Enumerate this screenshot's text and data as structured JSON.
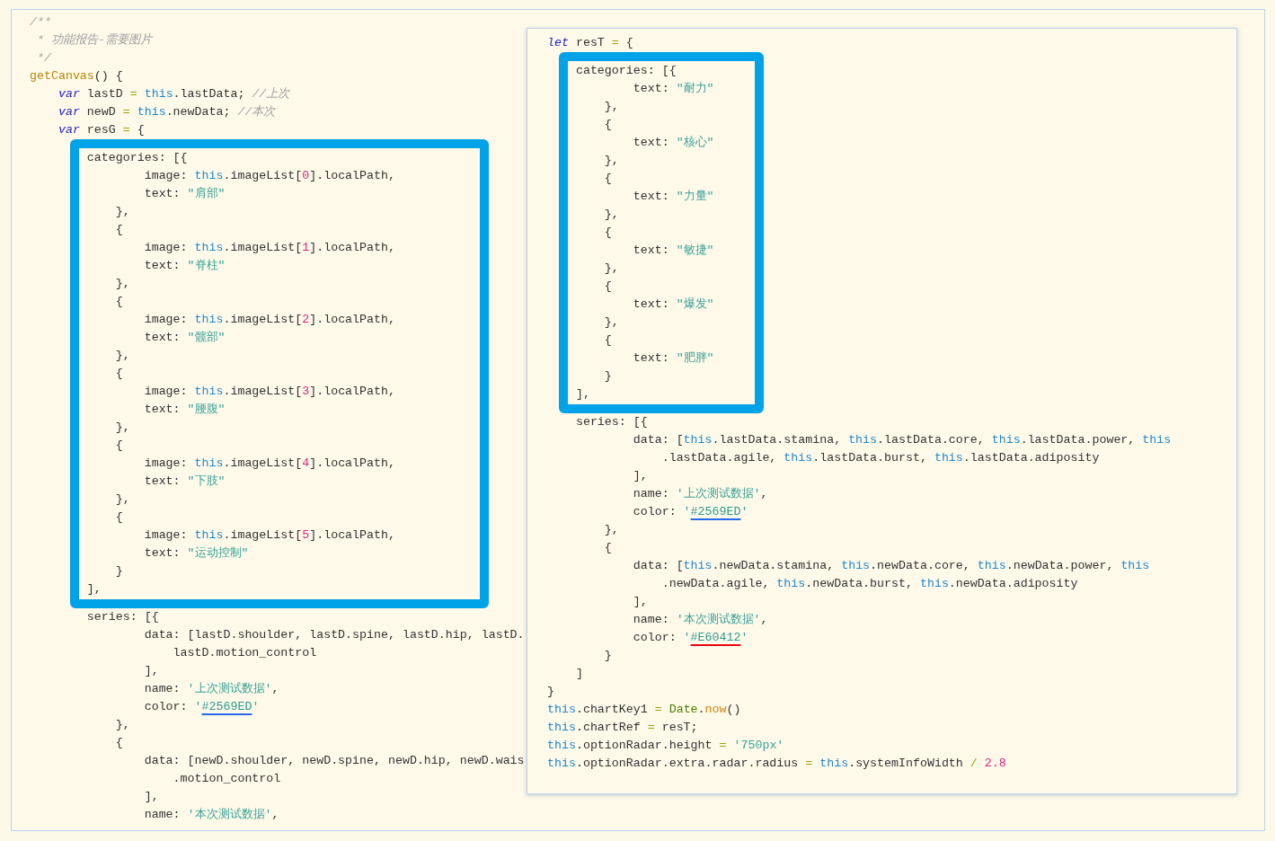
{
  "panels": [
    {
      "kind": "editor",
      "blocks": [
        {
          "highlighted": false,
          "lines": [
            [
              {
                "kind": "c",
                "text": "/**"
              }
            ],
            [
              {
                "kind": "c",
                "text": " * 功能报告-需要图片"
              }
            ],
            [
              {
                "kind": "c",
                "text": " */"
              }
            ],
            [
              {
                "kind": "f",
                "text": "getCanvas"
              },
              {
                "kind": "p",
                "text": "() {"
              }
            ],
            [
              {
                "kind": "k",
                "text": "    var"
              },
              {
                "kind": "p",
                "text": " lastD "
              },
              {
                "kind": "o",
                "text": "= "
              },
              {
                "kind": "t",
                "text": "this"
              },
              {
                "kind": "p",
                "text": ".lastData; "
              },
              {
                "kind": "c",
                "text": "//上次"
              }
            ],
            [
              {
                "kind": "k",
                "text": "    var"
              },
              {
                "kind": "p",
                "text": " newD "
              },
              {
                "kind": "o",
                "text": "= "
              },
              {
                "kind": "t",
                "text": "this"
              },
              {
                "kind": "p",
                "text": ".newData; "
              },
              {
                "kind": "c",
                "text": "//本次"
              }
            ],
            [
              {
                "kind": "k",
                "text": "    var"
              },
              {
                "kind": "p",
                "text": " resG "
              },
              {
                "kind": "o",
                "text": "="
              },
              {
                "kind": "p",
                "text": " {"
              }
            ]
          ]
        },
        {
          "highlighted": true,
          "lines": [
            [
              {
                "kind": "p",
                "text": "        categories: [{"
              }
            ],
            [
              {
                "kind": "p",
                "text": "                image: "
              },
              {
                "kind": "t",
                "text": "this"
              },
              {
                "kind": "p",
                "text": ".imageList["
              },
              {
                "kind": "n",
                "text": "0"
              },
              {
                "kind": "p",
                "text": "].localPath,"
              }
            ],
            [
              {
                "kind": "p",
                "text": "                text: "
              },
              {
                "kind": "s",
                "text": "\"肩部\""
              }
            ],
            [
              {
                "kind": "p",
                "text": "            },"
              }
            ],
            [
              {
                "kind": "p",
                "text": "            {"
              }
            ],
            [
              {
                "kind": "p",
                "text": "                image: "
              },
              {
                "kind": "t",
                "text": "this"
              },
              {
                "kind": "p",
                "text": ".imageList["
              },
              {
                "kind": "n",
                "text": "1"
              },
              {
                "kind": "p",
                "text": "].localPath,"
              }
            ],
            [
              {
                "kind": "p",
                "text": "                text: "
              },
              {
                "kind": "s",
                "text": "\"脊柱\""
              }
            ],
            [
              {
                "kind": "p",
                "text": "            },"
              }
            ],
            [
              {
                "kind": "p",
                "text": "            {"
              }
            ],
            [
              {
                "kind": "p",
                "text": "                image: "
              },
              {
                "kind": "t",
                "text": "this"
              },
              {
                "kind": "p",
                "text": ".imageList["
              },
              {
                "kind": "n",
                "text": "2"
              },
              {
                "kind": "p",
                "text": "].localPath,"
              }
            ],
            [
              {
                "kind": "p",
                "text": "                text: "
              },
              {
                "kind": "s",
                "text": "\"髋部\""
              }
            ],
            [
              {
                "kind": "p",
                "text": "            },"
              }
            ],
            [
              {
                "kind": "p",
                "text": "            {"
              }
            ],
            [
              {
                "kind": "p",
                "text": "                image: "
              },
              {
                "kind": "t",
                "text": "this"
              },
              {
                "kind": "p",
                "text": ".imageList["
              },
              {
                "kind": "n",
                "text": "3"
              },
              {
                "kind": "p",
                "text": "].localPath,"
              }
            ],
            [
              {
                "kind": "p",
                "text": "                text: "
              },
              {
                "kind": "s",
                "text": "\"腰腹\""
              }
            ],
            [
              {
                "kind": "p",
                "text": "            },"
              }
            ],
            [
              {
                "kind": "p",
                "text": "            {"
              }
            ],
            [
              {
                "kind": "p",
                "text": "                image: "
              },
              {
                "kind": "t",
                "text": "this"
              },
              {
                "kind": "p",
                "text": ".imageList["
              },
              {
                "kind": "n",
                "text": "4"
              },
              {
                "kind": "p",
                "text": "].localPath,"
              }
            ],
            [
              {
                "kind": "p",
                "text": "                text: "
              },
              {
                "kind": "s",
                "text": "\"下肢\""
              }
            ],
            [
              {
                "kind": "p",
                "text": "            },"
              }
            ],
            [
              {
                "kind": "p",
                "text": "            {"
              }
            ],
            [
              {
                "kind": "p",
                "text": "                image: "
              },
              {
                "kind": "t",
                "text": "this"
              },
              {
                "kind": "p",
                "text": ".imageList["
              },
              {
                "kind": "n",
                "text": "5"
              },
              {
                "kind": "p",
                "text": "].localPath,"
              }
            ],
            [
              {
                "kind": "p",
                "text": "                text: "
              },
              {
                "kind": "s",
                "text": "\"运动控制\""
              }
            ],
            [
              {
                "kind": "p",
                "text": "            }"
              }
            ],
            [
              {
                "kind": "p",
                "text": "        ],"
              }
            ]
          ]
        },
        {
          "highlighted": false,
          "lines": [
            [
              {
                "kind": "p",
                "text": "        series: [{"
              }
            ],
            [
              {
                "kind": "p",
                "text": "                data: [lastD.shoulder, lastD.spine, lastD.hip, lastD."
              }
            ],
            [
              {
                "kind": "p",
                "text": "                    lastD.motion_control"
              }
            ],
            [
              {
                "kind": "p",
                "text": "                ],"
              }
            ],
            [
              {
                "kind": "p",
                "text": "                name: "
              },
              {
                "kind": "s",
                "text": "'上次测试数据'"
              },
              {
                "kind": "p",
                "text": ","
              }
            ],
            [
              {
                "kind": "p",
                "text": "                color: "
              },
              {
                "kind": "s",
                "text": "'"
              },
              {
                "kind": "x",
                "text": "#2569ED",
                "color": "#2569ed"
              },
              {
                "kind": "s",
                "text": "'"
              }
            ],
            [
              {
                "kind": "p",
                "text": "            },"
              }
            ],
            [
              {
                "kind": "p",
                "text": "            {"
              }
            ],
            [
              {
                "kind": "p",
                "text": "                data: [newD.shoulder, newD.spine, newD.hip, newD.wais"
              }
            ],
            [
              {
                "kind": "p",
                "text": "                    .motion_control"
              }
            ],
            [
              {
                "kind": "p",
                "text": "                ],"
              }
            ],
            [
              {
                "kind": "p",
                "text": "                name: "
              },
              {
                "kind": "s",
                "text": "'本次测试数据'"
              },
              {
                "kind": "p",
                "text": ","
              }
            ]
          ]
        }
      ]
    },
    {
      "kind": "popup",
      "blocks": [
        {
          "highlighted": false,
          "lines": [
            [
              {
                "kind": "k",
                "text": "let"
              },
              {
                "kind": "p",
                "text": " resT "
              },
              {
                "kind": "o",
                "text": "="
              },
              {
                "kind": "p",
                "text": " {"
              }
            ]
          ]
        },
        {
          "highlighted": true,
          "lines": [
            [
              {
                "kind": "p",
                "text": "    categories: [{"
              }
            ],
            [
              {
                "kind": "p",
                "text": "            text: "
              },
              {
                "kind": "s",
                "text": "\"耐力\""
              }
            ],
            [
              {
                "kind": "p",
                "text": "        },"
              }
            ],
            [
              {
                "kind": "p",
                "text": "        {"
              }
            ],
            [
              {
                "kind": "p",
                "text": "            text: "
              },
              {
                "kind": "s",
                "text": "\"核心\""
              }
            ],
            [
              {
                "kind": "p",
                "text": "        },"
              }
            ],
            [
              {
                "kind": "p",
                "text": "        {"
              }
            ],
            [
              {
                "kind": "p",
                "text": "            text: "
              },
              {
                "kind": "s",
                "text": "\"力量\""
              }
            ],
            [
              {
                "kind": "p",
                "text": "        },"
              }
            ],
            [
              {
                "kind": "p",
                "text": "        {"
              }
            ],
            [
              {
                "kind": "p",
                "text": "            text: "
              },
              {
                "kind": "s",
                "text": "\"敏捷\""
              }
            ],
            [
              {
                "kind": "p",
                "text": "        },"
              }
            ],
            [
              {
                "kind": "p",
                "text": "        {"
              }
            ],
            [
              {
                "kind": "p",
                "text": "            text: "
              },
              {
                "kind": "s",
                "text": "\"爆发\""
              }
            ],
            [
              {
                "kind": "p",
                "text": "        },"
              }
            ],
            [
              {
                "kind": "p",
                "text": "        {"
              }
            ],
            [
              {
                "kind": "p",
                "text": "            text: "
              },
              {
                "kind": "s",
                "text": "\"肥胖\""
              }
            ],
            [
              {
                "kind": "p",
                "text": "        }"
              }
            ],
            [
              {
                "kind": "p",
                "text": "    ],"
              }
            ]
          ]
        },
        {
          "highlighted": false,
          "lines": [
            [
              {
                "kind": "p",
                "text": "    series: [{"
              }
            ],
            [
              {
                "kind": "p",
                "text": "            data: ["
              },
              {
                "kind": "t",
                "text": "this"
              },
              {
                "kind": "p",
                "text": ".lastData.stamina, "
              },
              {
                "kind": "t",
                "text": "this"
              },
              {
                "kind": "p",
                "text": ".lastData.core, "
              },
              {
                "kind": "t",
                "text": "this"
              },
              {
                "kind": "p",
                "text": ".lastData.power, "
              },
              {
                "kind": "t",
                "text": "this"
              }
            ],
            [
              {
                "kind": "p",
                "text": "                .lastData.agile, "
              },
              {
                "kind": "t",
                "text": "this"
              },
              {
                "kind": "p",
                "text": ".lastData.burst, "
              },
              {
                "kind": "t",
                "text": "this"
              },
              {
                "kind": "p",
                "text": ".lastData.adiposity"
              }
            ],
            [
              {
                "kind": "p",
                "text": "            ],"
              }
            ],
            [
              {
                "kind": "p",
                "text": "            name: "
              },
              {
                "kind": "s",
                "text": "'上次测试数据'"
              },
              {
                "kind": "p",
                "text": ","
              }
            ],
            [
              {
                "kind": "p",
                "text": "            color: "
              },
              {
                "kind": "s",
                "text": "'"
              },
              {
                "kind": "x",
                "text": "#2569ED",
                "color": "#2569ed"
              },
              {
                "kind": "s",
                "text": "'"
              }
            ],
            [
              {
                "kind": "p",
                "text": "        },"
              }
            ],
            [
              {
                "kind": "p",
                "text": "        {"
              }
            ],
            [
              {
                "kind": "p",
                "text": "            data: ["
              },
              {
                "kind": "t",
                "text": "this"
              },
              {
                "kind": "p",
                "text": ".newData.stamina, "
              },
              {
                "kind": "t",
                "text": "this"
              },
              {
                "kind": "p",
                "text": ".newData.core, "
              },
              {
                "kind": "t",
                "text": "this"
              },
              {
                "kind": "p",
                "text": ".newData.power, "
              },
              {
                "kind": "t",
                "text": "this"
              }
            ],
            [
              {
                "kind": "p",
                "text": "                .newData.agile, "
              },
              {
                "kind": "t",
                "text": "this"
              },
              {
                "kind": "p",
                "text": ".newData.burst, "
              },
              {
                "kind": "t",
                "text": "this"
              },
              {
                "kind": "p",
                "text": ".newData.adiposity"
              }
            ],
            [
              {
                "kind": "p",
                "text": "            ],"
              }
            ],
            [
              {
                "kind": "p",
                "text": "            name: "
              },
              {
                "kind": "s",
                "text": "'本次测试数据'"
              },
              {
                "kind": "p",
                "text": ","
              }
            ],
            [
              {
                "kind": "p",
                "text": "            color: "
              },
              {
                "kind": "s",
                "text": "'"
              },
              {
                "kind": "x",
                "text": "#E60412",
                "color": "#e60412"
              },
              {
                "kind": "s",
                "text": "'"
              }
            ],
            [
              {
                "kind": "p",
                "text": "        }"
              }
            ],
            [
              {
                "kind": "p",
                "text": "    ]"
              }
            ],
            [
              {
                "kind": "p",
                "text": "}"
              }
            ],
            [
              {
                "kind": "t",
                "text": "this"
              },
              {
                "kind": "p",
                "text": ".chartKey1 "
              },
              {
                "kind": "o",
                "text": "= "
              },
              {
                "kind": "g",
                "text": "Date"
              },
              {
                "kind": "p",
                "text": "."
              },
              {
                "kind": "m",
                "text": "now"
              },
              {
                "kind": "p",
                "text": "()"
              }
            ],
            [
              {
                "kind": "t",
                "text": "this"
              },
              {
                "kind": "p",
                "text": ".chartRef "
              },
              {
                "kind": "o",
                "text": "="
              },
              {
                "kind": "p",
                "text": " resT;"
              }
            ],
            [
              {
                "kind": "t",
                "text": "this"
              },
              {
                "kind": "p",
                "text": ".optionRadar.height "
              },
              {
                "kind": "o",
                "text": "="
              },
              {
                "kind": "s",
                "text": " '750px'"
              }
            ],
            [
              {
                "kind": "t",
                "text": "this"
              },
              {
                "kind": "p",
                "text": ".optionRadar.extra.radar.radius "
              },
              {
                "kind": "o",
                "text": "= "
              },
              {
                "kind": "t",
                "text": "this"
              },
              {
                "kind": "p",
                "text": ".systemInfoWidth "
              },
              {
                "kind": "o",
                "text": "/"
              },
              {
                "kind": "n",
                "text": " 2.8"
              }
            ]
          ]
        }
      ]
    }
  ]
}
